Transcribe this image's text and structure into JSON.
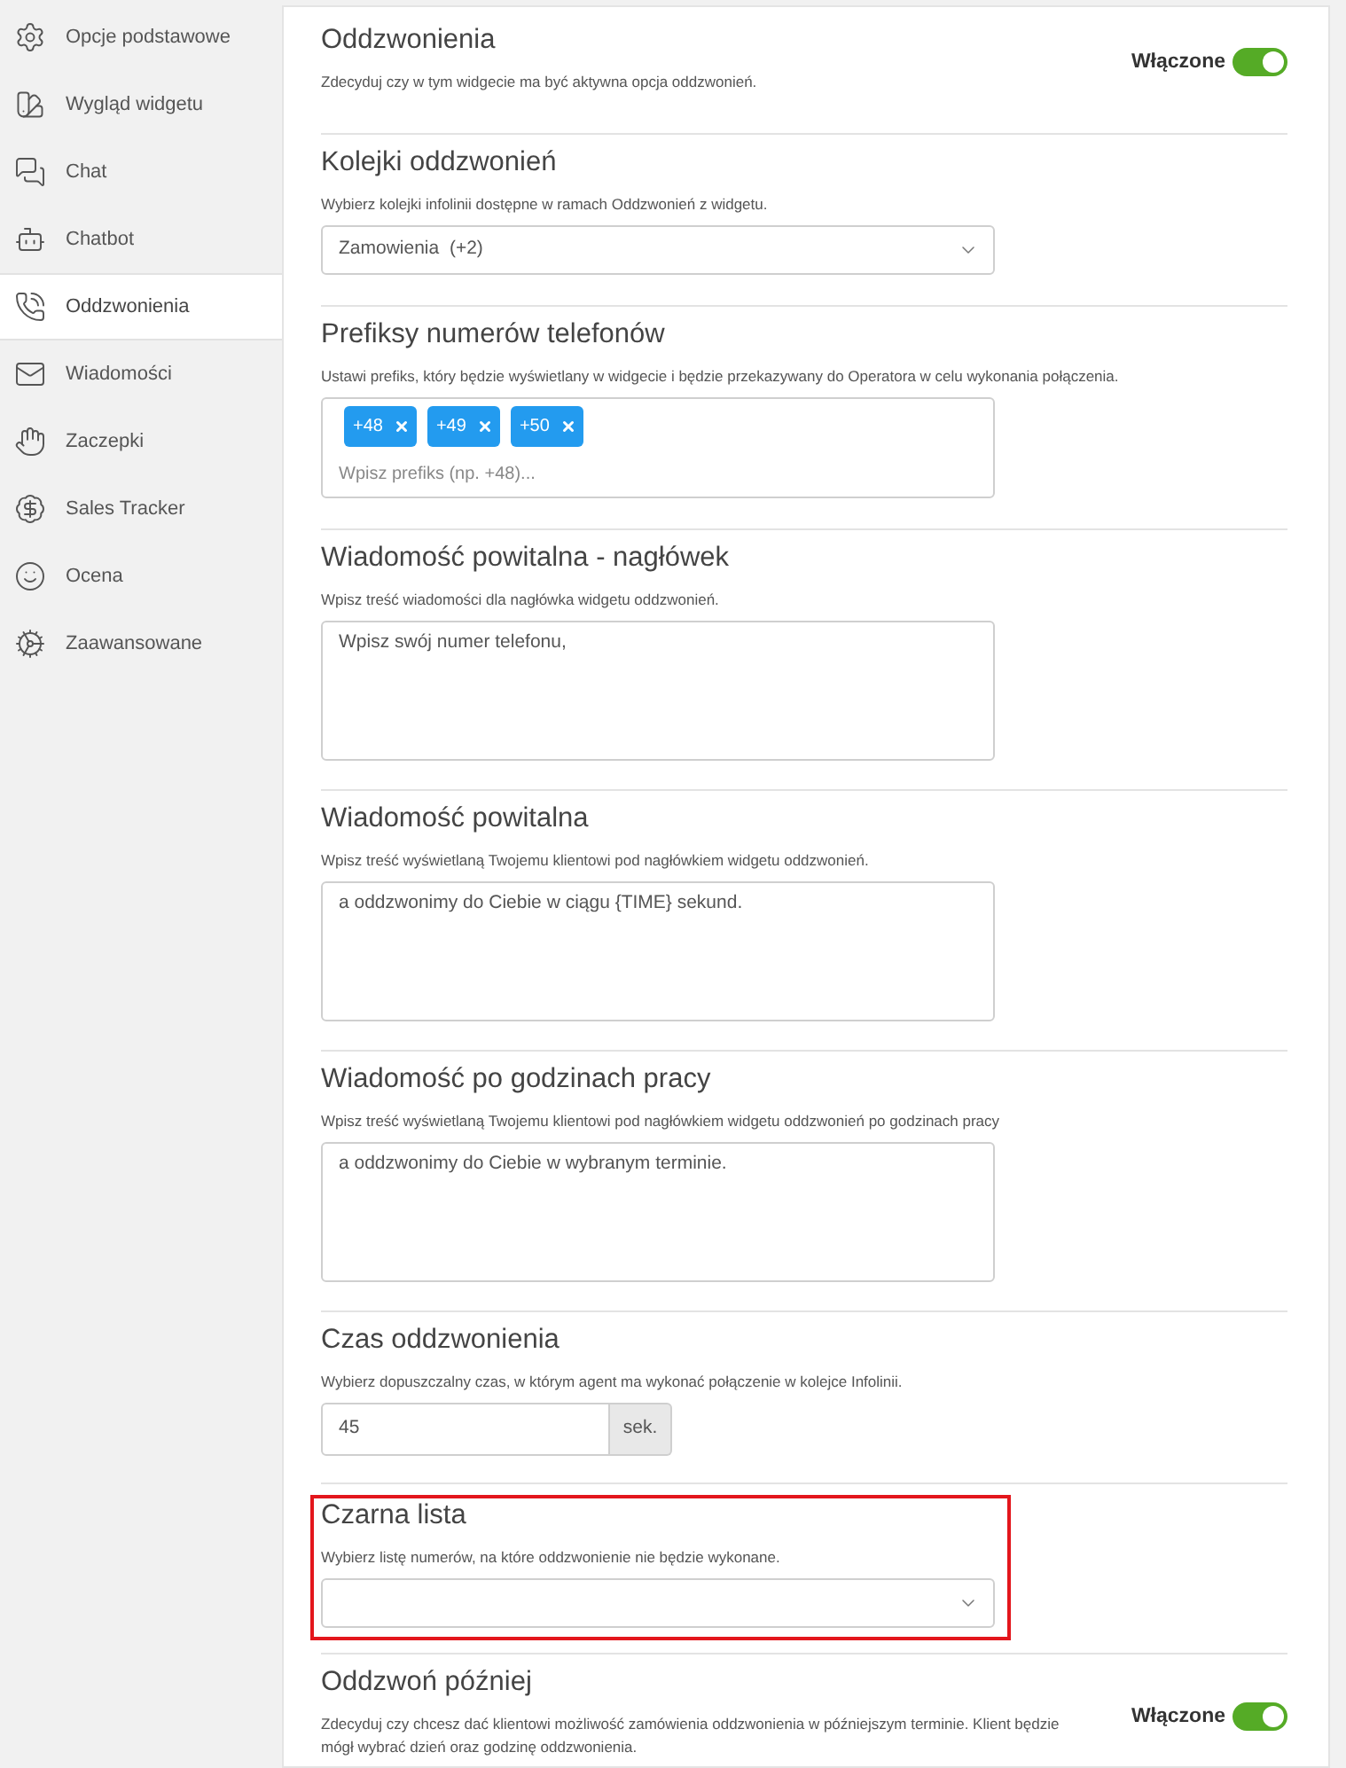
{
  "sidebar": {
    "items": [
      {
        "label": "Opcje podstawowe",
        "selected": false
      },
      {
        "label": "Wygląd widgetu",
        "selected": false
      },
      {
        "label": "Chat",
        "selected": false
      },
      {
        "label": "Chatbot",
        "selected": false
      },
      {
        "label": "Oddzwonienia",
        "selected": true
      },
      {
        "label": "Wiadomości",
        "selected": false
      },
      {
        "label": "Zaczepki",
        "selected": false
      },
      {
        "label": "Sales Tracker",
        "selected": false
      },
      {
        "label": "Ocena",
        "selected": false
      },
      {
        "label": "Zaawansowane",
        "selected": false
      }
    ]
  },
  "sections": [
    {
      "kind": "toggle",
      "title": "Oddzwonienia",
      "description": "Zdecyduj czy w tym widgecie ma być aktywna opcja oddzwonień.",
      "toggle": {
        "label": "Włączone",
        "on": true
      },
      "highlighted": false
    },
    {
      "kind": "select",
      "title": "Kolejki oddzwonień",
      "description": "Wybierz kolejki infolinii dostępne w ramach Oddzwonień z widgetu.",
      "value": "Zamowienia  (+2)",
      "highlighted": false
    },
    {
      "kind": "tags",
      "title": "Prefiksy numerów telefonów",
      "description": "Ustawi prefiks, który będzie wyświetlany w widgecie i będzie przekazywany do Operatora w celu wykonania połączenia.",
      "tags": [
        "+48",
        "+49",
        "+50"
      ],
      "placeholder": "Wpisz prefiks (np. +48)...",
      "highlighted": false
    },
    {
      "kind": "textarea",
      "title": "Wiadomość powitalna - nagłówek",
      "description": "Wpisz treść wiadomości dla nagłówka widgetu oddzwonień.",
      "value": "Wpisz swój numer telefonu,",
      "highlighted": false
    },
    {
      "kind": "textarea",
      "title": "Wiadomość powitalna",
      "description": "Wpisz treść wyświetlaną Twojemu klientowi pod nagłówkiem widgetu oddzwonień.",
      "value": "a oddzwonimy do Ciebie w ciągu {TIME} sekund.",
      "highlighted": false
    },
    {
      "kind": "textarea",
      "title": "Wiadomość po godzinach pracy",
      "description": "Wpisz treść wyświetlaną Twojemu klientowi pod nagłówkiem widgetu oddzwonień po godzinach pracy",
      "value": "a oddzwonimy do Ciebie w wybranym terminie.",
      "highlighted": false
    },
    {
      "kind": "number",
      "title": "Czas oddzwonienia",
      "description": "Wybierz dopuszczalny czas, w którym agent ma wykonać połączenie w kolejce Infolinii.",
      "value": "45",
      "unit": "sek.",
      "highlighted": false
    },
    {
      "kind": "select",
      "title": "Czarna lista",
      "description": "Wybierz listę numerów, na które oddzwonienie nie będzie wykonane.",
      "highlighted": true
    },
    {
      "kind": "toggle",
      "title": "Oddzwoń później",
      "description": "Zdecyduj czy chcesz dać klientowi możliwość zamówienia oddzwonienia w późniejszym terminie. Klient będzie mógł wybrać dzień oraz godzinę oddzwonienia.",
      "toggle": {
        "label": "Włączone",
        "on": true
      },
      "highlighted": false
    }
  ]
}
